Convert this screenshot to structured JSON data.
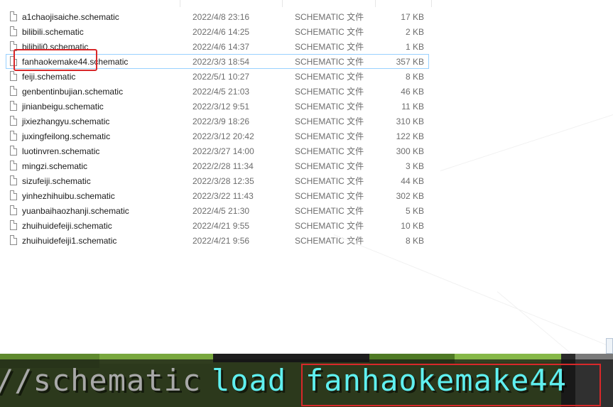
{
  "files": [
    {
      "name": "a1chaojisaiche.schematic",
      "date": "2022/4/8 23:16",
      "type": "SCHEMATIC 文件",
      "size": "17 KB",
      "selected": false
    },
    {
      "name": "bilibili.schematic",
      "date": "2022/4/6 14:25",
      "type": "SCHEMATIC 文件",
      "size": "2 KB",
      "selected": false
    },
    {
      "name": "bilibili0.schematic",
      "date": "2022/4/6 14:37",
      "type": "SCHEMATIC 文件",
      "size": "1 KB",
      "selected": false
    },
    {
      "name": "fanhaokemake44.schematic",
      "date": "2022/3/3 18:54",
      "type": "SCHEMATIC 文件",
      "size": "357 KB",
      "selected": true
    },
    {
      "name": "feiji.schematic",
      "date": "2022/5/1 10:27",
      "type": "SCHEMATIC 文件",
      "size": "8 KB",
      "selected": false
    },
    {
      "name": "genbentinbujian.schematic",
      "date": "2022/4/5 21:03",
      "type": "SCHEMATIC 文件",
      "size": "46 KB",
      "selected": false
    },
    {
      "name": "jinianbeigu.schematic",
      "date": "2022/3/12 9:51",
      "type": "SCHEMATIC 文件",
      "size": "11 KB",
      "selected": false
    },
    {
      "name": "jixiezhangyu.schematic",
      "date": "2022/3/9 18:26",
      "type": "SCHEMATIC 文件",
      "size": "310 KB",
      "selected": false
    },
    {
      "name": "juxingfeilong.schematic",
      "date": "2022/3/12 20:42",
      "type": "SCHEMATIC 文件",
      "size": "122 KB",
      "selected": false
    },
    {
      "name": "luotinvren.schematic",
      "date": "2022/3/27 14:00",
      "type": "SCHEMATIC 文件",
      "size": "300 KB",
      "selected": false
    },
    {
      "name": "mingzi.schematic",
      "date": "2022/2/28 11:34",
      "type": "SCHEMATIC 文件",
      "size": "3 KB",
      "selected": false
    },
    {
      "name": "sizufeiji.schematic",
      "date": "2022/3/28 12:35",
      "type": "SCHEMATIC 文件",
      "size": "44 KB",
      "selected": false
    },
    {
      "name": "yinhezhihuibu.schematic",
      "date": "2022/3/22 11:43",
      "type": "SCHEMATIC 文件",
      "size": "302 KB",
      "selected": false
    },
    {
      "name": "yuanbaihaozhanji.schematic",
      "date": "2022/4/5 21:30",
      "type": "SCHEMATIC 文件",
      "size": "5 KB",
      "selected": false
    },
    {
      "name": "zhuihuidefeiji.schematic",
      "date": "2022/4/21 9:55",
      "type": "SCHEMATIC 文件",
      "size": "10 KB",
      "selected": false
    },
    {
      "name": "zhuihuidefeiji1.schematic",
      "date": "2022/4/21 9:56",
      "type": "SCHEMATIC 文件",
      "size": "8 KB",
      "selected": false
    }
  ],
  "chat": {
    "prefix": "//schematic",
    "action": "load",
    "argument": "fanhaokemake44"
  },
  "colors": {
    "annotation_red": "#d8282a",
    "selection_border": "#99d1ff",
    "command_cyan": "#5ff0f0",
    "command_gray": "#a8a8a8"
  },
  "icons": {
    "file": "file-icon"
  }
}
